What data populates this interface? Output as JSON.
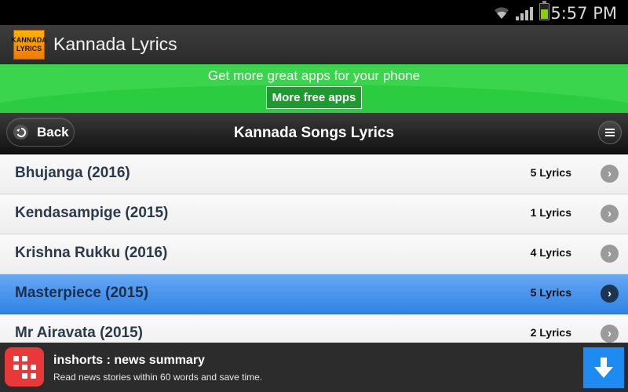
{
  "status_bar": {
    "time": "5:57 PM"
  },
  "action_bar": {
    "logo_text": [
      "KANNADA",
      "LYRICS"
    ],
    "title": "Kannada Lyrics"
  },
  "promo": {
    "text": "Get more great apps for your phone",
    "button_label": "More free apps"
  },
  "nav": {
    "back_label": "Back",
    "title": "Kannada Songs Lyrics"
  },
  "list": {
    "items": [
      {
        "title": "Bhujanga (2016)",
        "count": "5 Lyrics",
        "selected": false
      },
      {
        "title": "Kendasampige (2015)",
        "count": "1 Lyrics",
        "selected": false
      },
      {
        "title": "Krishna Rukku (2016)",
        "count": "4 Lyrics",
        "selected": false
      },
      {
        "title": "Masterpiece (2015)",
        "count": "5 Lyrics",
        "selected": true
      },
      {
        "title": "Mr Airavata (2015)",
        "count": "2 Lyrics",
        "selected": false
      }
    ]
  },
  "ad": {
    "title": "inshorts : news summary",
    "description": "Read news stories within 60 words and save time."
  },
  "colors": {
    "promo_green": "#3bd54d",
    "selected_blue": "#2f82e6",
    "ad_red": "#e83838",
    "download_blue": "#1d8bf1"
  },
  "icons": {
    "wifi": "wifi-icon",
    "signal": "signal-icon",
    "battery": "battery-icon",
    "back": "back-arrow-icon",
    "menu": "menu-icon",
    "chevron": "chevron-right-icon",
    "download": "download-arrow-icon"
  }
}
